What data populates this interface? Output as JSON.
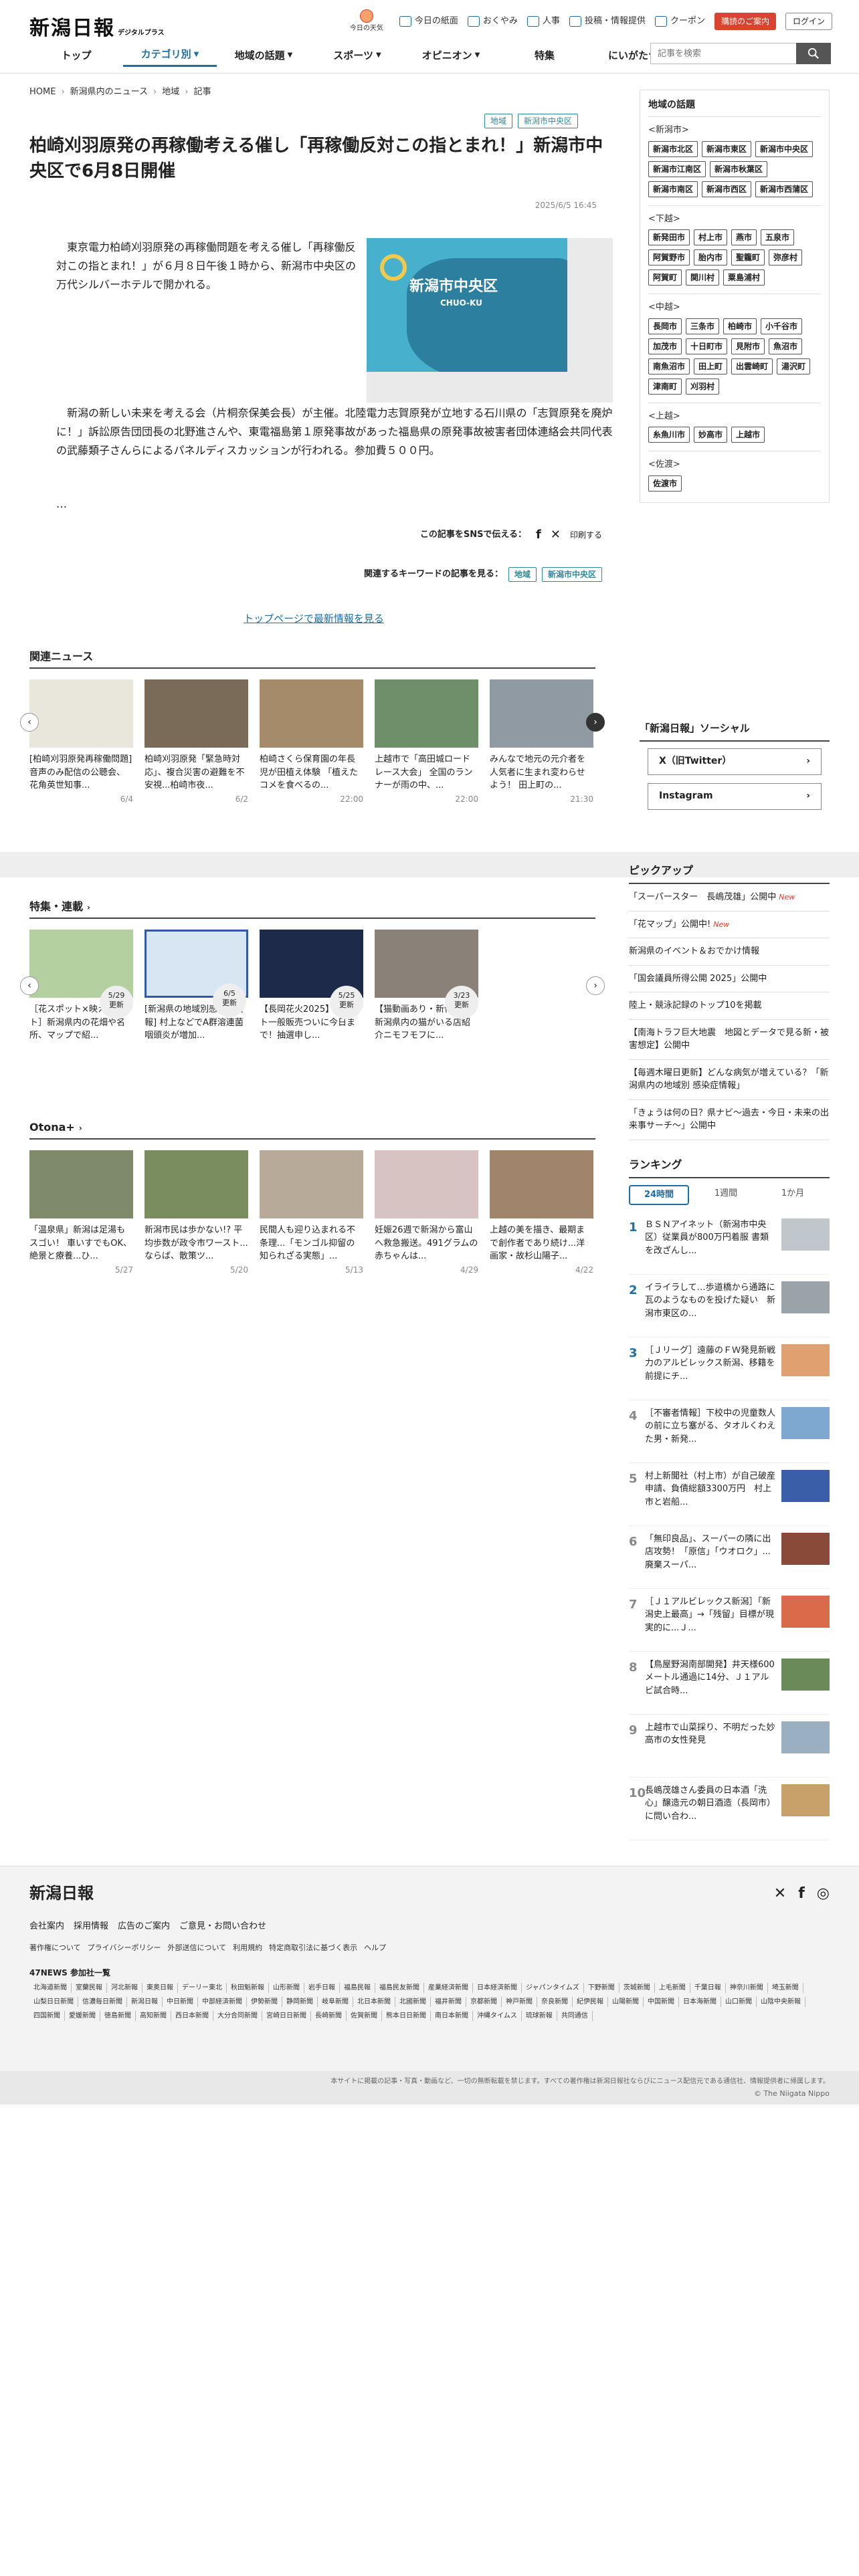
{
  "header": {
    "logo": "新潟日報",
    "logo_sub": "デジタルプラス",
    "today_label": "今日の天気",
    "util": [
      "今日の紙面",
      "おくやみ",
      "人事",
      "投稿・情報提供",
      "クーポン"
    ],
    "subscribe": "購読のご案内",
    "login": "ログイン",
    "nav": [
      "トップ",
      "カテゴリ別",
      "地域の話題",
      "スポーツ",
      "オピニオン",
      "特集",
      "にいがたナビ"
    ],
    "search_placeholder": "記事を検索"
  },
  "breadcrumb": [
    "HOME",
    "新潟県内のニュース",
    "地域",
    "記事"
  ],
  "article": {
    "tags": [
      "地域",
      "新潟市中央区"
    ],
    "title": "柏崎刈羽原発の再稼働考える催し「再稼働反対この指とまれ！」新潟市中央区で6月8日開催",
    "date": "2025/6/5 16:45",
    "p1": "東京電力柏崎刈羽原発の再稼働問題を考える催し「再稼働反対この指とまれ！」が６月８日午後１時から、新潟市中央区の万代シルバーホテルで開かれる。",
    "p2": "新潟の新しい未来を考える会（片桐奈保美会長）が主催。北陸電力志賀原発が立地する石川県の「志賀原発を廃炉に！」訴訟原告団団長の北野進さんや、東電福島第１原発事故があった福島県の原発事故被害者団体連絡会共同代表の武藤類子さんらによるパネルディスカッションが行われる。参加費５００円。",
    "ellipsis": "…",
    "photo_title": "新潟市中央区",
    "photo_sub": "CHUO-KU",
    "share_label": "この記事をSNSで伝える：",
    "print": "印刷する",
    "kw_label": "関連するキーワードの記事を見る：",
    "top_link": "トップページで最新情報を見る"
  },
  "related": {
    "title": "関連ニュース",
    "items": [
      {
        "desc": "[柏崎刈羽原発再稼働問題] 音声のみ配信の公聴会、花角英世知事...",
        "when": "6/4"
      },
      {
        "desc": "柏崎刈羽原発「緊急時対応」、複合災害の避難を不安視...柏崎市夜...",
        "when": "6/2"
      },
      {
        "desc": "柏崎さくら保育園の年長児が田植え体験 「植えたコメを食べるの...",
        "when": "22:00"
      },
      {
        "desc": "上越市で「高田城ロードレース大会」 全国のランナーが雨の中、...",
        "when": "22:00"
      },
      {
        "desc": "みんなで地元の元介者を人気者に生まれ変わらせよう！ 田上町の...",
        "when": "21:30"
      }
    ]
  },
  "special": {
    "title": "特集・連載",
    "items": [
      {
        "desc": "［花スポット×映えスポット］新潟県内の花畑や名所、マップで紹...",
        "badge": "5/29\n更新"
      },
      {
        "desc": "[新潟県の地域別感染症情報] 村上などでA群溶連菌咽頭炎が増加...",
        "badge": "6/5\n更新"
      },
      {
        "desc": "【長岡花火2025】チケット一般販売ついに今日まで！抽選申し...",
        "badge": "5/25\n更新"
      },
      {
        "desc": "【猫動画あり・新作追加】新潟県内の猫がいる店紹介ニモフモフに...",
        "badge": "3/23\n更新"
      }
    ]
  },
  "otona": {
    "title": "Otona+",
    "items": [
      {
        "desc": "「温泉県」新潟は足湯もスゴい！ 車いすでもOK、絶景と療養...ひ...",
        "when": "5/27"
      },
      {
        "desc": "新潟市民は歩かない!? 平均歩数が政令市ワースト...ならば、散策ツ...",
        "when": "5/20"
      },
      {
        "desc": "民間人も迎り込まれる不条理...「モンゴル抑留の知られざる実態」...",
        "when": "5/13"
      },
      {
        "desc": "妊娠26週で新潟から富山へ救急搬送。491グラムの赤ちゃんは...",
        "when": "4/29"
      },
      {
        "desc": "上越の美を描き、最期まで創作者であり続け...洋画家・故杉山陽子...",
        "when": "4/22"
      }
    ]
  },
  "sidebar": {
    "title": "地域の話題",
    "groups": [
      {
        "name": "<新潟市>",
        "items": [
          "新潟市北区",
          "新潟市東区",
          "新潟市中央区",
          "新潟市江南区",
          "新潟市秋葉区",
          "新潟市南区",
          "新潟市西区",
          "新潟市西蒲区"
        ]
      },
      {
        "name": "<下越>",
        "items": [
          "新発田市",
          "村上市",
          "燕市",
          "五泉市",
          "阿賀野市",
          "胎内市",
          "聖籠町",
          "弥彦村",
          "阿賀町",
          "関川村",
          "粟島浦村"
        ]
      },
      {
        "name": "<中越>",
        "items": [
          "長岡市",
          "三条市",
          "柏崎市",
          "小千谷市",
          "加茂市",
          "十日町市",
          "見附市",
          "魚沼市",
          "南魚沼市",
          "田上町",
          "出雲崎町",
          "湯沢町",
          "津南町",
          "刈羽村"
        ]
      },
      {
        "name": "<上越>",
        "items": [
          "糸魚川市",
          "妙高市",
          "上越市"
        ]
      },
      {
        "name": "<佐渡>",
        "items": [
          "佐渡市"
        ]
      }
    ]
  },
  "social": {
    "title": "「新潟日報」ソーシャル",
    "items": [
      "X（旧Twitter）",
      "Instagram"
    ]
  },
  "pickup": {
    "title": "ピックアップ",
    "items": [
      {
        "text": "「スーパースター　長嶋茂雄」公開中",
        "new": "New"
      },
      {
        "text": "「花マップ」公開中!",
        "new": "New"
      },
      {
        "text": "新潟県のイベント＆おでかけ情報",
        "new": ""
      },
      {
        "text": "「国会議員所得公開 2025」公開中",
        "new": ""
      },
      {
        "text": "陸上・競泳記録のトップ10を掲載",
        "new": ""
      },
      {
        "text": "【南海トラフ巨大地震　地図とデータで見る新・被害想定】公開中",
        "new": ""
      },
      {
        "text": "【毎週木曜日更新】どんな病気が増えている？「新潟県内の地域別 感染症情報」",
        "new": ""
      },
      {
        "text": "「きょうは何の日？県ナビ～過去・今日・未来の出来事サーチ～」公開中",
        "new": ""
      }
    ]
  },
  "ranking": {
    "title": "ランキング",
    "tabs": [
      "24時間",
      "1週間",
      "1か月"
    ],
    "items": [
      {
        "num": "1",
        "text": "ＢＳＮアイネット（新潟市中央区）従業員が800万円着服 書類を改ざんし..."
      },
      {
        "num": "2",
        "text": "イライラして…歩道橋から通路に瓦のようなものを投げた疑い　新潟市東区の..."
      },
      {
        "num": "3",
        "text": "［Ｊリーグ］遠藤のＦＷ発見新戦力のアルビレックス新潟、移籍を前提にチ..."
      },
      {
        "num": "4",
        "text": "［不審者情報］下校中の児童数人の前に立ち塞がる、タオルくわえた男・新発..."
      },
      {
        "num": "5",
        "text": "村上新聞社（村上市）が自己破産申請、負債総額3300万円　村上市と岩船..."
      },
      {
        "num": "6",
        "text": "「無印良品」、スーパーの隣に出店攻勢！「原信」「ウオロク」...廃棄スーパ..."
      },
      {
        "num": "7",
        "text": "［Ｊ１アルビレックス新潟］「新潟史上最高」→「残留」目標が現実的に...Ｊ..."
      },
      {
        "num": "8",
        "text": "【鳥屋野潟南部開発】井天様600メートル通過に14分、Ｊ１アルビ試合時..."
      },
      {
        "num": "9",
        "text": "上越市で山菜採り、不明だった妙高市の女性発見"
      },
      {
        "num": "10",
        "text": "長嶋茂雄さん委員の日本酒「洗心」醸造元の朝日酒造（長岡市）に問い合わ..."
      }
    ]
  },
  "footer": {
    "logo": "新潟日報",
    "links": [
      "会社案内",
      "採用情報",
      "広告のご案内",
      "ご意見・お問い合わせ"
    ],
    "links2": [
      "著作権について",
      "プライバシーポリシー",
      "外部送信について",
      "利用規約",
      "特定商取引法に基づく表示",
      "ヘルプ"
    ],
    "news47": "47NEWS 参加社一覧",
    "papers": [
      "北海道新聞",
      "室蘭民報",
      "河北新報",
      "東奥日報",
      "デーリー東北",
      "秋田魁新報",
      "山形新聞",
      "岩手日報",
      "福島民報",
      "福島民友新聞",
      "産業経済新聞",
      "日本経済新聞",
      "ジャパンタイムズ",
      "下野新聞",
      "茨城新聞",
      "上毛新聞",
      "千葉日報",
      "神奈川新聞",
      "埼玉新聞",
      "山梨日日新聞",
      "信濃毎日新聞",
      "新潟日報",
      "中日新聞",
      "中部経済新聞",
      "伊勢新聞",
      "静岡新聞",
      "岐阜新聞",
      "北日本新聞",
      "北國新聞",
      "福井新聞",
      "京都新聞",
      "神戸新聞",
      "奈良新聞",
      "紀伊民報",
      "山陽新聞",
      "中国新聞",
      "日本海新聞",
      "山口新聞",
      "山陰中央新報",
      "四国新聞",
      "愛媛新聞",
      "徳島新聞",
      "高知新聞",
      "西日本新聞",
      "大分合同新聞",
      "宮崎日日新聞",
      "長崎新聞",
      "佐賀新聞",
      "熊本日日新聞",
      "南日本新聞",
      "沖縄タイムス",
      "琉球新報",
      "共同通信"
    ],
    "copy1": "本サイトに掲載の記事・写真・動画など、一切の無断転載を禁じます。すべての著作権は新潟日報社ならびにニュース配信元である通信社、情報提供者に帰属します。",
    "copy2": "© The Niigata Nippo"
  }
}
